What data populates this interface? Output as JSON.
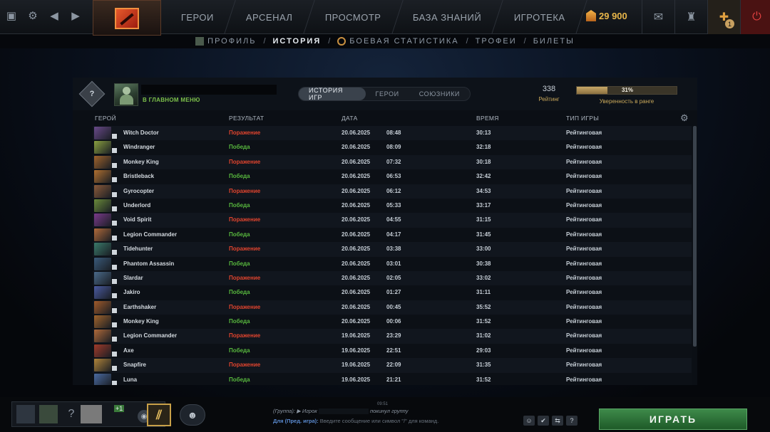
{
  "topbar": {
    "nav": [
      "ГЕРОИ",
      "АРСЕНАЛ",
      "ПРОСМОТР",
      "БАЗА ЗНАНИЙ",
      "ИГРОТЕКА"
    ],
    "currency": "29 900",
    "notification_count": "1"
  },
  "subnav": {
    "profile": "ПРОФИЛЬ",
    "history": "ИСТОРИЯ",
    "stats": "БОЕВАЯ СТАТИСТИКА",
    "trophies": "ТРОФЕИ",
    "tickets": "БИЛЕТЫ",
    "separator": "/"
  },
  "player": {
    "rank_emblem_text": "?",
    "status": "В ГЛАВНОМ МЕНЮ",
    "rating": "338",
    "rating_label": "Рейтинг",
    "confidence": "31%",
    "confidence_fraction": 0.31,
    "confidence_label": "Уверенность в ранге"
  },
  "tabs": [
    "ИСТОРИЯ ИГР",
    "ГЕРОИ",
    "СОЮЗНИКИ"
  ],
  "columns": {
    "hero": "ГЕРОЙ",
    "result": "РЕЗУЛЬТАТ",
    "date": "ДАТА",
    "duration": "ВРЕМЯ",
    "type": "ТИП ИГРЫ"
  },
  "matches": [
    {
      "hero": "Witch Doctor",
      "result": "Поражение",
      "win": false,
      "date": "20.06.2025",
      "time": "08:48",
      "duration": "30:13",
      "type": "Рейтинговая",
      "color": "#6a4a8a"
    },
    {
      "hero": "Windranger",
      "result": "Победа",
      "win": true,
      "date": "20.06.2025",
      "time": "08:09",
      "duration": "32:18",
      "type": "Рейтинговая",
      "color": "#8aa040"
    },
    {
      "hero": "Monkey King",
      "result": "Поражение",
      "win": false,
      "date": "20.06.2025",
      "time": "07:32",
      "duration": "30:18",
      "type": "Рейтинговая",
      "color": "#a0642c"
    },
    {
      "hero": "Bristleback",
      "result": "Победа",
      "win": true,
      "date": "20.06.2025",
      "time": "06:53",
      "duration": "32:42",
      "type": "Рейтинговая",
      "color": "#b07030"
    },
    {
      "hero": "Gyrocopter",
      "result": "Поражение",
      "win": false,
      "date": "20.06.2025",
      "time": "06:12",
      "duration": "34:53",
      "type": "Рейтинговая",
      "color": "#8a5a3a"
    },
    {
      "hero": "Underlord",
      "result": "Победа",
      "win": true,
      "date": "20.06.2025",
      "time": "05:33",
      "duration": "33:17",
      "type": "Рейтинговая",
      "color": "#6a8a3a"
    },
    {
      "hero": "Void Spirit",
      "result": "Поражение",
      "win": false,
      "date": "20.06.2025",
      "time": "04:55",
      "duration": "31:15",
      "type": "Рейтинговая",
      "color": "#7a3a8a"
    },
    {
      "hero": "Legion Commander",
      "result": "Победа",
      "win": true,
      "date": "20.06.2025",
      "time": "04:17",
      "duration": "31:45",
      "type": "Рейтинговая",
      "color": "#b06a3a"
    },
    {
      "hero": "Tidehunter",
      "result": "Поражение",
      "win": false,
      "date": "20.06.2025",
      "time": "03:38",
      "duration": "33:00",
      "type": "Рейтинговая",
      "color": "#3a7a6a"
    },
    {
      "hero": "Phantom Assassin",
      "result": "Победа",
      "win": true,
      "date": "20.06.2025",
      "time": "03:01",
      "duration": "30:38",
      "type": "Рейтинговая",
      "color": "#3a5a7a"
    },
    {
      "hero": "Slardar",
      "result": "Поражение",
      "win": false,
      "date": "20.06.2025",
      "time": "02:05",
      "duration": "33:02",
      "type": "Рейтинговая",
      "color": "#4a6a8a"
    },
    {
      "hero": "Jakiro",
      "result": "Победа",
      "win": true,
      "date": "20.06.2025",
      "time": "01:27",
      "duration": "31:11",
      "type": "Рейтинговая",
      "color": "#4a5aa0"
    },
    {
      "hero": "Earthshaker",
      "result": "Поражение",
      "win": false,
      "date": "20.06.2025",
      "time": "00:45",
      "duration": "35:52",
      "type": "Рейтинговая",
      "color": "#a05a2a"
    },
    {
      "hero": "Monkey King",
      "result": "Победа",
      "win": true,
      "date": "20.06.2025",
      "time": "00:06",
      "duration": "31:52",
      "type": "Рейтинговая",
      "color": "#a0642c"
    },
    {
      "hero": "Legion Commander",
      "result": "Поражение",
      "win": false,
      "date": "19.06.2025",
      "time": "23:29",
      "duration": "31:02",
      "type": "Рейтинговая",
      "color": "#b06a3a"
    },
    {
      "hero": "Axe",
      "result": "Победа",
      "win": true,
      "date": "19.06.2025",
      "time": "22:51",
      "duration": "29:03",
      "type": "Рейтинговая",
      "color": "#a03a2a"
    },
    {
      "hero": "Snapfire",
      "result": "Поражение",
      "win": false,
      "date": "19.06.2025",
      "time": "22:09",
      "duration": "31:35",
      "type": "Рейтинговая",
      "color": "#b0843a"
    },
    {
      "hero": "Luna",
      "result": "Победа",
      "win": true,
      "date": "19.06.2025",
      "time": "21:21",
      "duration": "31:52",
      "type": "Рейтинговая",
      "color": "#4a6aa0"
    }
  ],
  "party": {
    "plus_tag": "+1",
    "help_glyph": "?"
  },
  "chat": {
    "time": "09:51",
    "log_prefix": "(Группа): ▶ Игрок",
    "log_suffix": "покинул группу",
    "channel": "Для (Пред. игра):",
    "placeholder": "Введите сообщение или символ \"/\" для команд."
  },
  "play_button": "ИГРАТЬ",
  "colors": {
    "win": "#58b83e",
    "loss": "#e0442e",
    "accent_gold": "#c9a85a",
    "play_green": "#3e8a4a"
  },
  "icons": {
    "top_left": [
      "fullscreen-icon",
      "gear-icon",
      "back-arrow-icon",
      "forward-arrow-icon"
    ],
    "top_right": [
      "mail-icon",
      "armory-icon",
      "plus-tutorial-icon",
      "power-icon"
    ]
  }
}
